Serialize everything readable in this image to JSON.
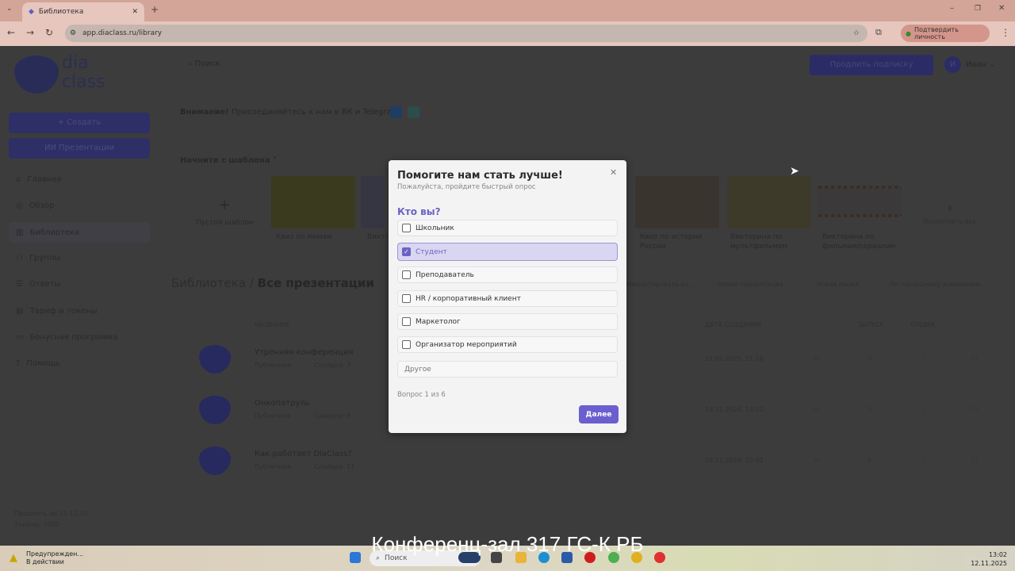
{
  "browser": {
    "tab_title": "Библиотека",
    "url": "app.diaclass.ru/library",
    "identity_button": "Подтвердить личность"
  },
  "app": {
    "logo": "dia class",
    "search_placeholder": "Поиск",
    "extend_subscription": "Продлить подписку",
    "user_initial": "И",
    "user_name": "Иван",
    "create_button": "+ Создать",
    "ai_button": "ИИ Презентации",
    "nav": [
      {
        "label": "Главная"
      },
      {
        "label": "Обзор"
      },
      {
        "label": "Библиотека"
      },
      {
        "label": "Группы"
      },
      {
        "label": "Ответы"
      },
      {
        "label": "Тариф и токены"
      },
      {
        "label": "Бонусная программа"
      },
      {
        "label": "Помощь"
      }
    ],
    "subscription_until": "Продлить до 11.12.25",
    "tokens": "Токены: 7000",
    "notice_bold": "Внимание!",
    "notice_text": "Присоединяйтесь к нам в ВК и Telegram!",
    "templates_heading": "Начните с шаблона",
    "templates": [
      {
        "label": "Пустой шаблон"
      },
      {
        "label": "Квиз по мемам"
      },
      {
        "label": "Викторина..."
      },
      {
        "label": "Квиз по истории России"
      },
      {
        "label": "Викторина по мультфильмам"
      },
      {
        "label": "Викторина по фильмам/сериалам"
      }
    ],
    "view_all": "Посмотреть все",
    "breadcrumb_root": "Библиотека",
    "breadcrumb_sep": "/",
    "page_title": "Все презентации",
    "actions": [
      "Импортировать из ...",
      "Новая презентация",
      "Новая папка",
      "По последнему изменению"
    ],
    "columns": {
      "name": "НАЗВАНИЕ",
      "created": "ДАТА СОЗДАНИЯ",
      "launch": "ЗАПУСК",
      "options": "ОПЦИИ"
    },
    "rows": [
      {
        "title": "Утренняя конференция",
        "visibility": "Публичная",
        "slides": "Слайдов: 7",
        "date": "11.02.2025, 11:16"
      },
      {
        "title": "Онкопатруль",
        "visibility": "Публичная",
        "slides": "Слайдов: 8",
        "date": "18.11.2024, 13:02"
      },
      {
        "title": "Как работает DiaClass?",
        "visibility": "Публичная",
        "slides": "Слайдов: 11",
        "date": "18.11.2024, 22:01"
      }
    ]
  },
  "modal": {
    "title": "Помогите нам стать лучше!",
    "subtitle": "Пожалуйста, пройдите быстрый опрос",
    "question": "Кто вы?",
    "options": [
      {
        "label": "Школьник",
        "checked": false
      },
      {
        "label": "Студент",
        "checked": true
      },
      {
        "label": "Преподаватель",
        "checked": false
      },
      {
        "label": "HR / корпоративный клиент",
        "checked": false
      },
      {
        "label": "Маркетолог",
        "checked": false
      },
      {
        "label": "Организатор мероприятий",
        "checked": false
      }
    ],
    "other_placeholder": "Другое",
    "progress": "Вопрос 1 из 6",
    "next_button": "Далее"
  },
  "caption": "Конференц-зал 317 ГС-К РБ",
  "taskbar": {
    "notification_title": "Предупрежден...",
    "notification_sub": "В действии",
    "search": "Поиск",
    "time": "13:02",
    "date": "12.11.2025"
  },
  "colors": {
    "accent": "#6b5fcf",
    "selected_bg": "#d9d6f1"
  }
}
